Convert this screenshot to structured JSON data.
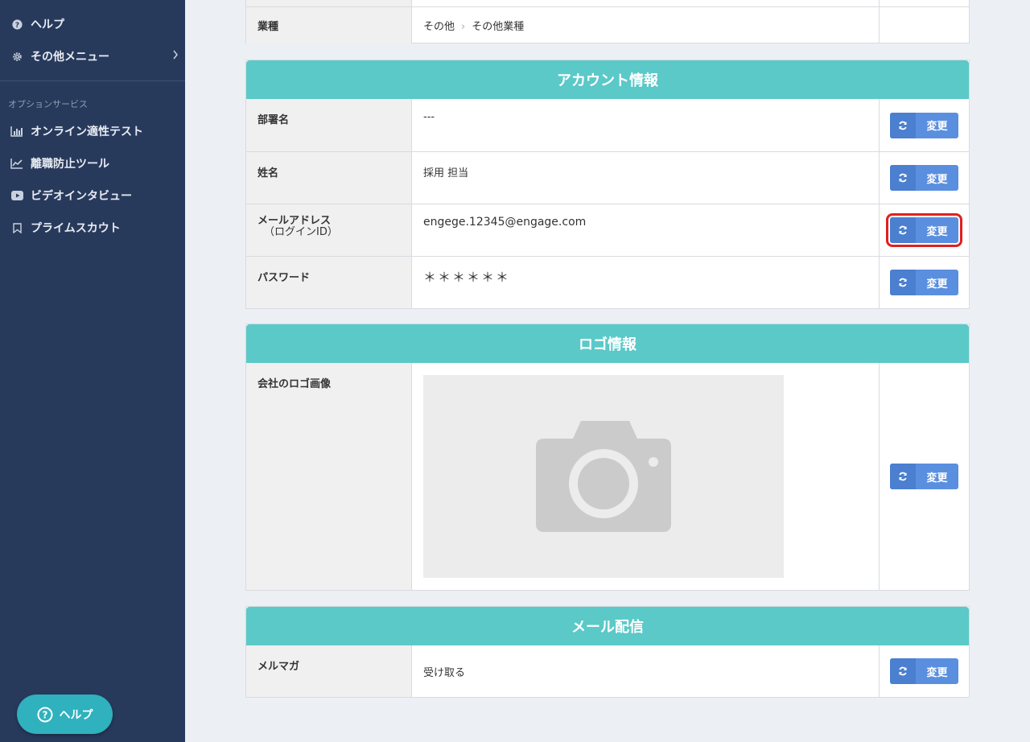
{
  "sidebar": {
    "items_top": [
      {
        "label": "ヘルプ",
        "icon": "question-circle-icon"
      },
      {
        "label": "その他メニュー",
        "icon": "gear-icon"
      }
    ],
    "section_label": "オプションサービス",
    "items_option": [
      {
        "label": "オンライン適性テスト",
        "icon": "bar-chart-icon"
      },
      {
        "label": "離職防止ツール",
        "icon": "line-chart-icon"
      },
      {
        "label": "ビデオインタビュー",
        "icon": "video-icon"
      },
      {
        "label": "プライムスカウト",
        "icon": "bookmark-icon"
      }
    ],
    "help_button": "ヘルプ"
  },
  "company": {
    "industry_label": "業種",
    "industry_path": [
      "その他",
      "その他業種"
    ]
  },
  "account": {
    "title": "アカウント情報",
    "rows": [
      {
        "label": "部署名",
        "value": "---"
      },
      {
        "label": "姓名",
        "value": "採用 担当"
      },
      {
        "label": "メールアドレス",
        "sublabel": "（ログインID）",
        "value": "engege.12345@engage.com"
      },
      {
        "label": "パスワード",
        "value": "＊＊＊＊＊＊"
      }
    ]
  },
  "logo": {
    "title": "ロゴ情報",
    "label": "会社のロゴ画像"
  },
  "mail": {
    "title": "メール配信",
    "label": "メルマガ",
    "value": "受け取る"
  },
  "button_label": "変更",
  "colors": {
    "sidebar": "#283a5c",
    "header": "#5ac9c8",
    "button": "#5a8fe0",
    "highlight": "#e02020"
  }
}
